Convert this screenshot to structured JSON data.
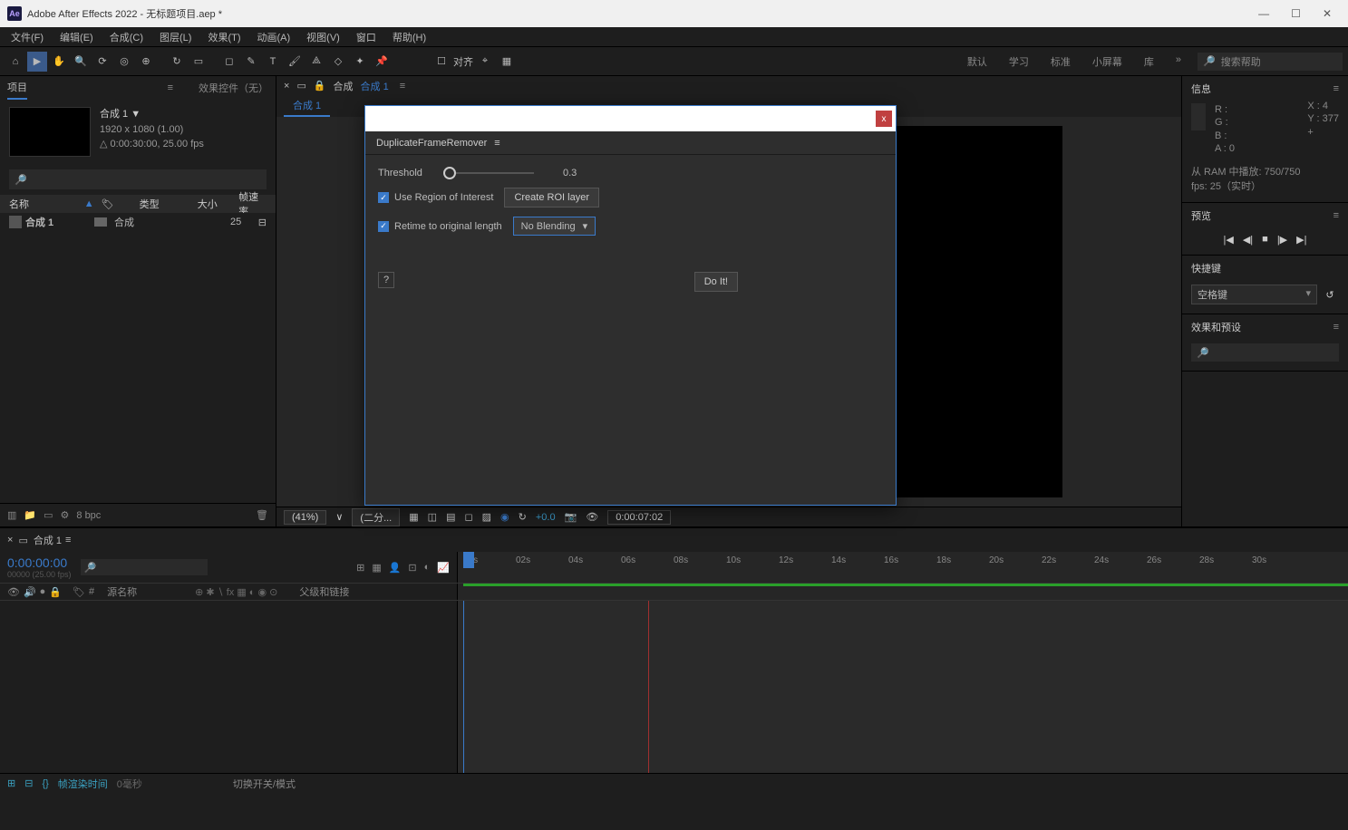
{
  "window": {
    "title": "Adobe After Effects 2022 - 无标题项目.aep *"
  },
  "menu": {
    "file": "文件(F)",
    "edit": "编辑(E)",
    "composition": "合成(C)",
    "layer": "图层(L)",
    "effect": "效果(T)",
    "animation": "动画(A)",
    "view": "视图(V)",
    "window": "窗口",
    "help": "帮助(H)"
  },
  "toolbar": {
    "align_label": "对齐"
  },
  "workspaces": {
    "default": "默认",
    "learn": "学习",
    "standard": "标准",
    "small": "小屏幕",
    "libraries": "库",
    "more": "»"
  },
  "search_help_placeholder": "搜索帮助",
  "project_panel": {
    "tab_project": "项目",
    "tab_fx": "效果控件（无）",
    "comp_name": "合成 1 ▼",
    "comp_res": "1920 x 1080 (1.00)",
    "comp_dur": "△ 0:00:30:00, 25.00 fps",
    "col_name": "名称",
    "col_type": "类型",
    "col_size": "大小",
    "col_fps": "帧速率",
    "row_name": "合成 1",
    "row_type": "合成",
    "row_fps": "25",
    "bpc": "8 bpc"
  },
  "viewer": {
    "top_label_prefix": "合成",
    "top_comp": "合成 1",
    "tab": "合成 1",
    "zoom": "(41%)",
    "res": "(二分...",
    "exposure": "+0.0",
    "timecode": "0:00:07:02"
  },
  "info": {
    "title": "信息",
    "r": "R :",
    "g": "G :",
    "b": "B :",
    "a": "A :  0",
    "x": "X : 4",
    "y": "Y : 377",
    "ram": "从 RAM 中播放: 750/750",
    "fps": "fps: 25（实时）"
  },
  "preview": {
    "title": "预览"
  },
  "shortcuts": {
    "title": "快捷键",
    "value": "空格键"
  },
  "fx_presets": {
    "title": "效果和预设"
  },
  "timeline": {
    "tab": "合成 1",
    "time": "0:00:00:00",
    "time_sub": "00000 (25.00 fps)",
    "col_source": "源名称",
    "col_parent": "父级和链接",
    "footer_render": "帧渲染时间",
    "footer_render_val": "0毫秒",
    "footer_switch": "切换开关/模式",
    "ticks": [
      "00s",
      "02s",
      "04s",
      "06s",
      "08s",
      "10s",
      "12s",
      "14s",
      "16s",
      "18s",
      "20s",
      "22s",
      "24s",
      "26s",
      "28s",
      "30s"
    ]
  },
  "dialog": {
    "title": "DuplicateFrameRemover",
    "threshold_label": "Threshold",
    "threshold_value": "0.3",
    "use_roi": "Use Region of Interest",
    "create_roi_btn": "Create ROI layer",
    "retime": "Retime to original length",
    "blending_value": "No Blending",
    "help": "?",
    "do_it": "Do It!"
  }
}
